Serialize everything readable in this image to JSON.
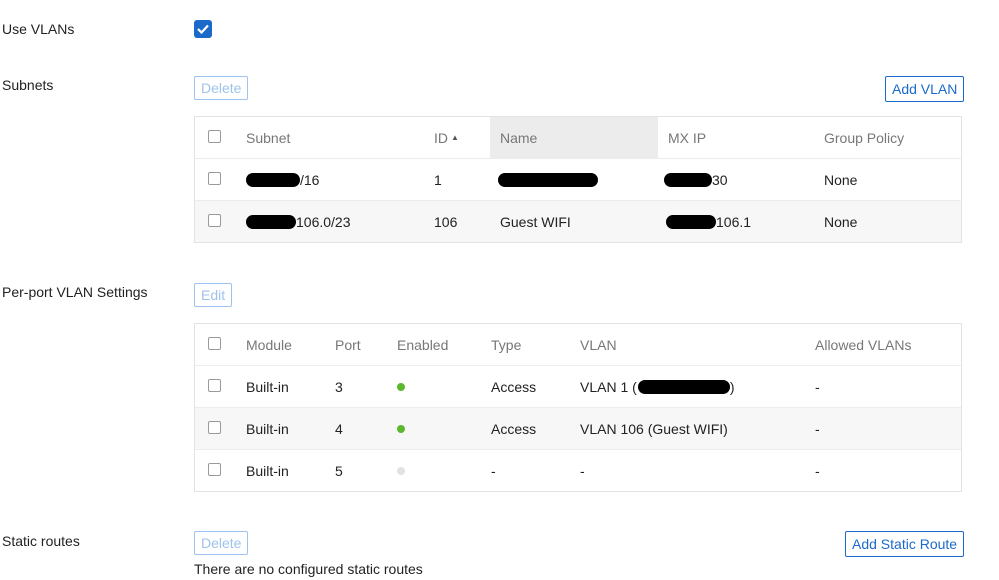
{
  "vlans": {
    "use_vlans_label": "Use VLANs",
    "use_vlans_checked": true,
    "accent_color": "#1b6ac9"
  },
  "subnets": {
    "label": "Subnets",
    "delete_label": "Delete",
    "add_label": "Add VLAN",
    "columns": [
      "Subnet",
      "ID",
      "Name",
      "MX IP",
      "Group Policy"
    ],
    "sort_indicator": "▲",
    "rows": [
      {
        "subnet": "/16",
        "id": "1",
        "name": "",
        "mx_ip": "30",
        "group_policy": "None"
      },
      {
        "subnet": "106.0/23",
        "id": "106",
        "name": "Guest WIFI",
        "mx_ip": "106.1",
        "group_policy": "None"
      }
    ]
  },
  "ports": {
    "label": "Per-port VLAN Settings",
    "edit_label": "Edit",
    "columns": [
      "Module",
      "Port",
      "Enabled",
      "Type",
      "VLAN",
      "Allowed VLANs"
    ],
    "rows": [
      {
        "module": "Built-in",
        "port": "3",
        "enabled": true,
        "type": "Access",
        "vlan": "VLAN 1 (",
        "vlan_suffix": ")",
        "allowed": "-"
      },
      {
        "module": "Built-in",
        "port": "4",
        "enabled": true,
        "type": "Access",
        "vlan": "VLAN 106 (Guest WIFI)",
        "vlan_suffix": "",
        "allowed": "-"
      },
      {
        "module": "Built-in",
        "port": "5",
        "enabled": false,
        "type": "-",
        "vlan": "-",
        "vlan_suffix": "",
        "allowed": "-"
      }
    ],
    "enabled_color": "#5cb82e",
    "disabled_color": "#e2e2e2"
  },
  "static_routes": {
    "label": "Static routes",
    "delete_label": "Delete",
    "add_label": "Add Static Route",
    "empty_message": "There are no configured static routes"
  }
}
